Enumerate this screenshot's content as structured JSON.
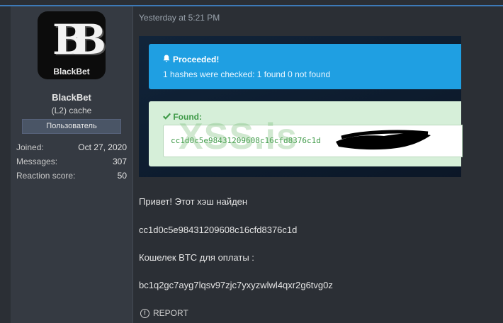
{
  "user": {
    "avatar_text": "BlackBet",
    "avatar_logo": "BB",
    "name": "BlackBet",
    "title": "(L2) cache",
    "banner": "Пользователь",
    "stats": [
      {
        "label": "Joined:",
        "value": "Oct 27, 2020"
      },
      {
        "label": "Messages:",
        "value": "307"
      },
      {
        "label": "Reaction score:",
        "value": "50"
      }
    ]
  },
  "post": {
    "timestamp": "Yesterday at 5:21 PM",
    "screenshot": {
      "proceeded_title": "Proceeded!",
      "proceeded_text": "1 hashes were checked: 1 found 0 not found",
      "found_title": "Found:",
      "hash_value": "cc1d0c5e98431209608c16cfd8376c1d",
      "watermark": "XSS.is"
    },
    "lines": [
      "Привет! Этот хэш найден",
      "cc1d0c5e98431209608c16cfd8376c1d",
      "Кошелек BTC для оплаты :",
      "bc1q2gc7ayg7lqsv97zjc7yxyzwlwl4qxr2g6tvg0z"
    ],
    "report_label": "REPORT"
  },
  "icons": {
    "bell": "bell-icon",
    "check": "check-icon",
    "report": "report-icon"
  },
  "colors": {
    "accent_line": "#3d7ab8",
    "alert_blue": "#1f9fe2",
    "alert_green": "#d6efd9",
    "found_text": "#3f9a48"
  }
}
